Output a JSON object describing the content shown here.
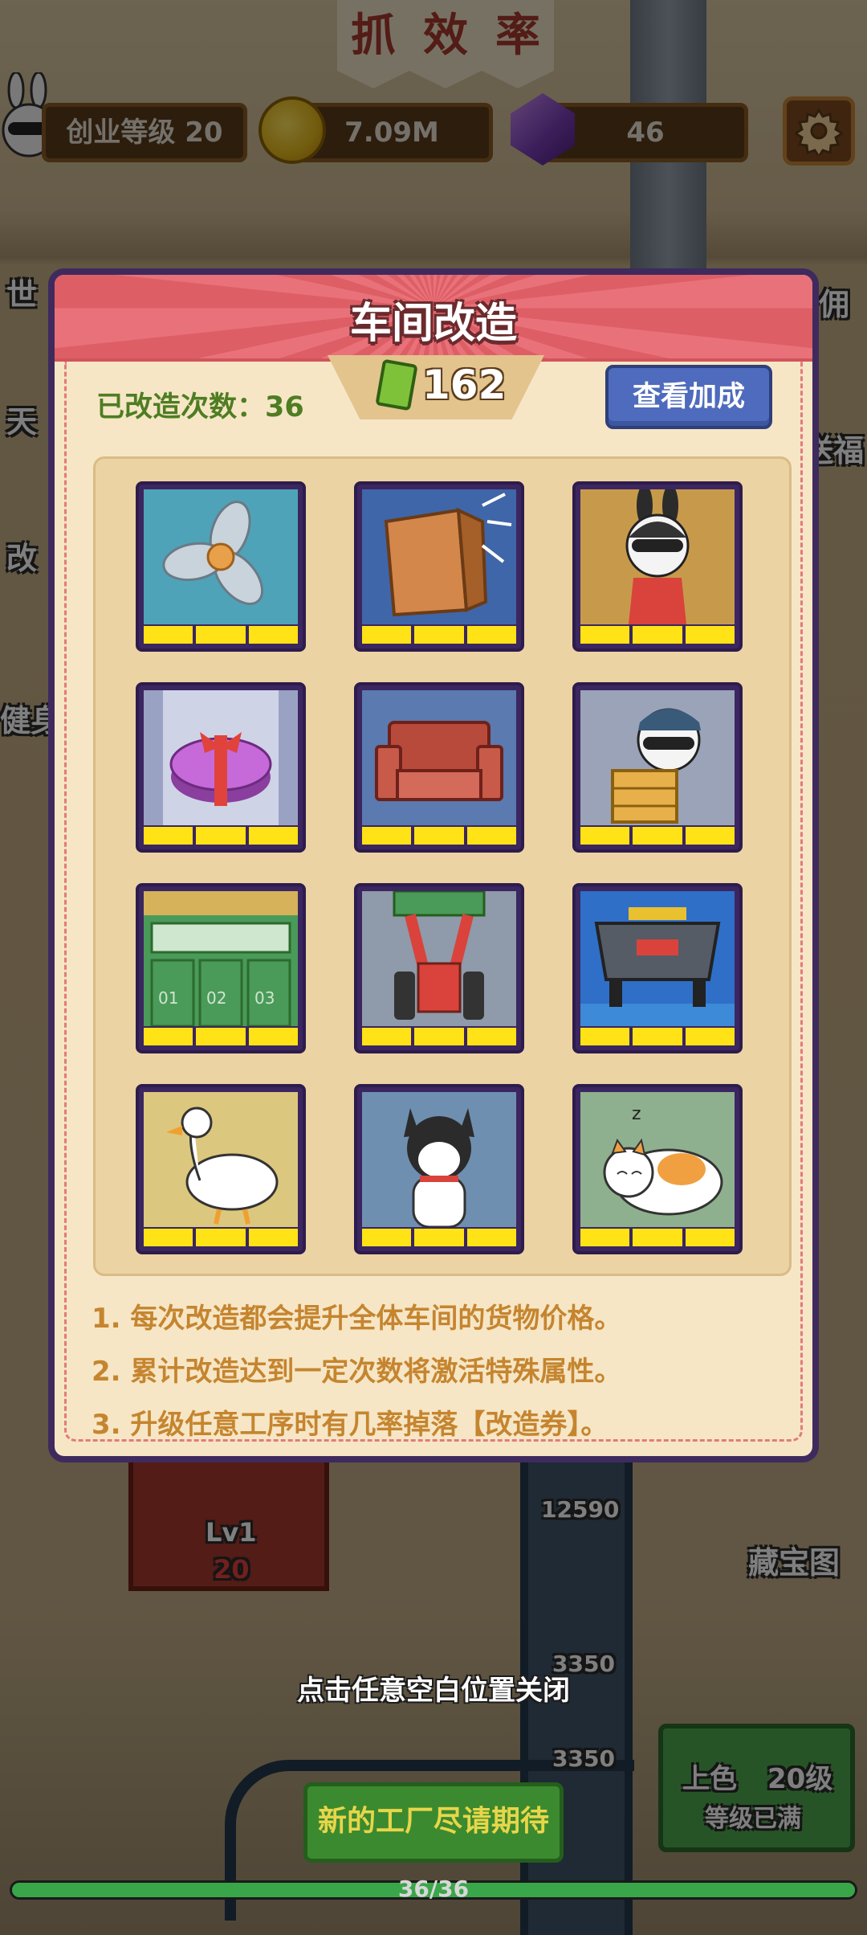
{
  "hud": {
    "level_label": "创业等级 20",
    "coins": "7.09M",
    "gems": "46"
  },
  "scene": {
    "banner_chars": [
      "抓",
      "效",
      "率"
    ],
    "side_labels": {
      "world": "世",
      "sky": "天",
      "modify": "改",
      "fitness": "健身",
      "hire": "佣",
      "gift": "送福"
    },
    "machine_level": "Lv1",
    "machine_cost": "20",
    "belt_values": [
      "12590",
      "3350",
      "3350"
    ],
    "treasure_map": "藏宝图",
    "station_name": "上色",
    "station_level": "20级",
    "station_status": "等级已满"
  },
  "modal": {
    "title": "车间改造",
    "count_label": "已改造次数：36",
    "tickets": "162",
    "bonus_button": "查看加成",
    "cards": [
      {
        "name": "fan"
      },
      {
        "name": "wooden-cabinet"
      },
      {
        "name": "rabbit-worker"
      },
      {
        "name": "gift-box"
      },
      {
        "name": "red-sofa"
      },
      {
        "name": "rabbit-carrying-box"
      },
      {
        "name": "warehouse-doors"
      },
      {
        "name": "forklift"
      },
      {
        "name": "conveyor-machine"
      },
      {
        "name": "duck"
      },
      {
        "name": "husky-dog"
      },
      {
        "name": "sleeping-cat"
      }
    ],
    "rules": [
      "1. 每次改造都会提升全体车间的货物价格。",
      "2. 累计改造达到一定次数将激活特殊属性。",
      "3. 升级任意工序时有几率掉落【改造券】。"
    ]
  },
  "footer": {
    "close_hint": "点击任意空白位置关闭",
    "new_factory_button": "新的工厂尽请期待",
    "progress_text": "36/36",
    "progress_fraction": 1.0
  },
  "colors": {
    "modal_border": "#3f2a5e",
    "header_red": "#e9727a",
    "bar_yellow": "#ffe316",
    "button_blue": "#4f6bbd",
    "count_green": "#4e7d22",
    "rules_orange": "#c5852f"
  }
}
